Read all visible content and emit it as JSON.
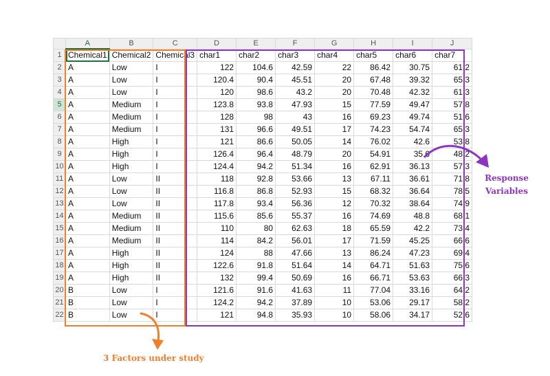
{
  "spreadsheet": {
    "column_headers": [
      "A",
      "B",
      "C",
      "D",
      "E",
      "F",
      "G",
      "H",
      "I",
      "J"
    ],
    "selected_column": "A",
    "selected_row": 5,
    "row_numbers": [
      1,
      2,
      3,
      4,
      5,
      6,
      7,
      8,
      9,
      10,
      11,
      12,
      13,
      14,
      15,
      16,
      17,
      18,
      19,
      20,
      21,
      22
    ],
    "rows": [
      [
        "Chemical1",
        "Chemical2",
        "Chemical3",
        "char1",
        "char2",
        "char3",
        "char4",
        "char5",
        "char6",
        "char7"
      ],
      [
        "A",
        "Low",
        "I",
        "122",
        "104.6",
        "42.59",
        "22",
        "86.42",
        "30.75",
        "61.2"
      ],
      [
        "A",
        "Low",
        "I",
        "120.4",
        "90.4",
        "45.51",
        "20",
        "67.48",
        "39.32",
        "65.3"
      ],
      [
        "A",
        "Low",
        "I",
        "120",
        "98.6",
        "43.2",
        "20",
        "70.48",
        "42.32",
        "61.3"
      ],
      [
        "A",
        "Medium",
        "I",
        "123.8",
        "93.8",
        "47.93",
        "15",
        "77.59",
        "49.47",
        "57.8"
      ],
      [
        "A",
        "Medium",
        "I",
        "128",
        "98",
        "43",
        "16",
        "69.23",
        "49.74",
        "51.6"
      ],
      [
        "A",
        "Medium",
        "I",
        "131",
        "96.6",
        "49.51",
        "17",
        "74.23",
        "54.74",
        "65.3"
      ],
      [
        "A",
        "High",
        "I",
        "121",
        "86.6",
        "50.05",
        "14",
        "76.02",
        "42.6",
        "53.8"
      ],
      [
        "A",
        "High",
        "I",
        "126.4",
        "96.4",
        "48.79",
        "20",
        "54.91",
        "35.6",
        "48.2"
      ],
      [
        "A",
        "High",
        "I",
        "124.4",
        "94.2",
        "51.34",
        "16",
        "62.91",
        "36.13",
        "57.3"
      ],
      [
        "A",
        "Low",
        "II",
        "118",
        "92.8",
        "53.66",
        "13",
        "67.11",
        "36.61",
        "71.8"
      ],
      [
        "A",
        "Low",
        "II",
        "116.8",
        "86.8",
        "52.93",
        "15",
        "68.32",
        "36.64",
        "78.5"
      ],
      [
        "A",
        "Low",
        "II",
        "117.8",
        "93.4",
        "56.36",
        "12",
        "70.32",
        "38.64",
        "74.9"
      ],
      [
        "A",
        "Medium",
        "II",
        "115.6",
        "85.6",
        "55.37",
        "16",
        "74.69",
        "48.8",
        "68.1"
      ],
      [
        "A",
        "Medium",
        "II",
        "110",
        "80",
        "62.63",
        "18",
        "65.59",
        "42.2",
        "73.4"
      ],
      [
        "A",
        "Medium",
        "II",
        "114",
        "84.2",
        "56.01",
        "17",
        "71.59",
        "45.25",
        "66.6"
      ],
      [
        "A",
        "High",
        "II",
        "124",
        "88",
        "47.66",
        "13",
        "86.24",
        "47.23",
        "69.4"
      ],
      [
        "A",
        "High",
        "II",
        "122.6",
        "91.8",
        "51.64",
        "14",
        "64.71",
        "51.63",
        "75.6"
      ],
      [
        "A",
        "High",
        "II",
        "132",
        "99.4",
        "50.69",
        "16",
        "66.71",
        "53.63",
        "66.3"
      ],
      [
        "B",
        "Low",
        "I",
        "121.6",
        "91.6",
        "41.63",
        "11",
        "77.04",
        "33.16",
        "64.2"
      ],
      [
        "B",
        "Low",
        "I",
        "124.2",
        "94.2",
        "37.89",
        "10",
        "53.06",
        "29.17",
        "58.2"
      ],
      [
        "B",
        "Low",
        "I",
        "121",
        "94.8",
        "35.93",
        "10",
        "58.06",
        "34.17",
        "52.6"
      ]
    ]
  },
  "annotations": {
    "factors_label": "3 Factors under study",
    "response_label_line1": "Response",
    "response_label_line2": "Variables",
    "factors_color": "#f07f2a",
    "response_color": "#8e34c4"
  }
}
